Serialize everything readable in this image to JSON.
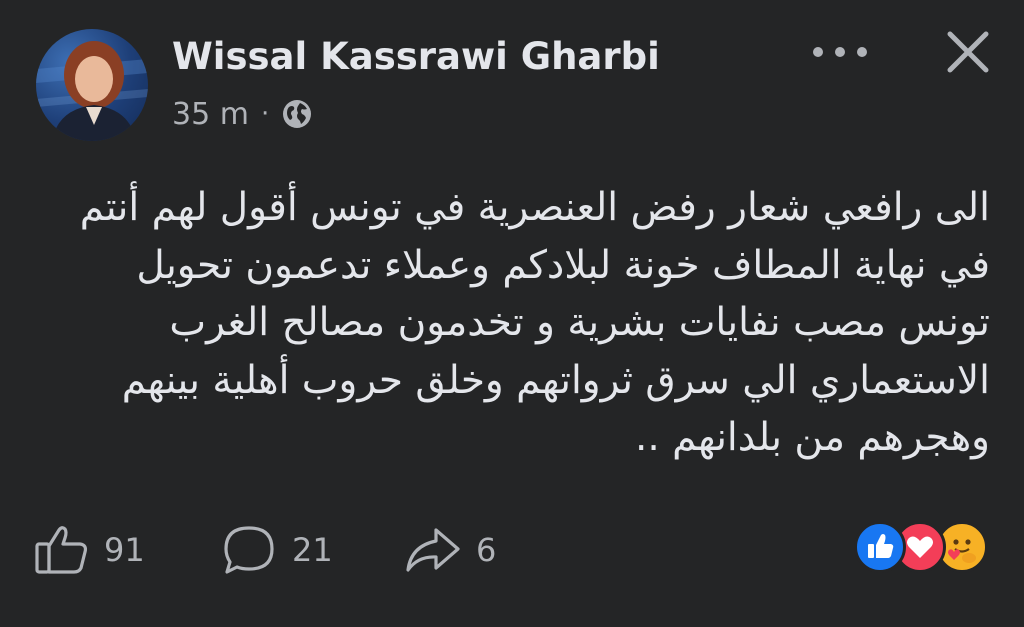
{
  "post": {
    "author": "Wissal Kassrawi Gharbi",
    "time": "35 m",
    "separator": "·",
    "privacy_icon": "globe-icon",
    "body": "الى رافعي شعار رفض العنصرية في تونس أقول لهم أنتم\nفي نهاية المطاف خونة لبلادكم وعملاء تدعمون تحويل\nتونس مصب نفايات بشرية و تخدمون مصالح الغرب\nالاستعماري الي سرق ثرواتهم وخلق حروب أهلية بينهم\nوهجرهم من بلدانهم .."
  },
  "header": {
    "more_icon": "more-horizontal-icon",
    "close_icon": "close-icon"
  },
  "actions": {
    "like_count": "91",
    "comment_count": "21",
    "share_count": "6"
  },
  "reactions": [
    "like-reaction-icon",
    "love-reaction-icon",
    "care-reaction-icon"
  ],
  "colors": {
    "background": "#242526",
    "text": "#e4e6eb",
    "secondary": "#b0b3b8",
    "like_blue": "#1877f2",
    "love_red": "#f33e58",
    "care_yellow": "#f7b125"
  }
}
